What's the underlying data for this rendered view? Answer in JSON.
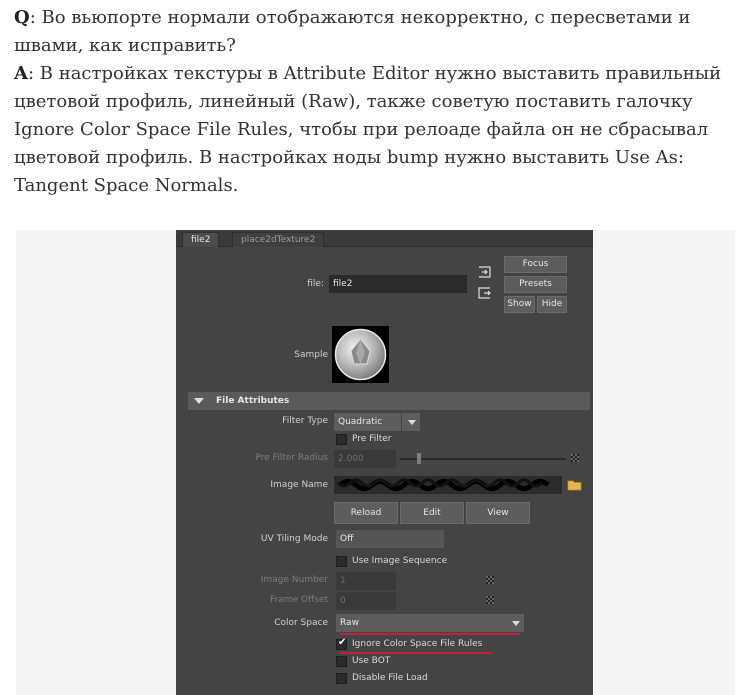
{
  "qa": {
    "q_label": "Q",
    "q_text": ": Во вьюпорте нормали отображаются некорректно, с пересветами и швами, как исправить?",
    "a_label": "A",
    "a_text": ": В настройках текстуры в Attribute Editor нужно выставить правильный цветовой профиль, линейный (Raw), также советую поставить галочку Ignore Color Space File Rules, чтобы при релоаде файла он не сбрасывал цветовой профиль. В настройках ноды bump нужно выставить Use As: Tangent Space Normals."
  },
  "editor": {
    "tabs": [
      {
        "label": "file2",
        "active": true
      },
      {
        "label": "place2dTexture2",
        "active": false
      }
    ],
    "node": {
      "label": "file:",
      "value": "file2"
    },
    "buttons": {
      "focus": "Focus",
      "presets": "Presets",
      "show": "Show",
      "hide": "Hide"
    },
    "sample_label": "Sample",
    "section_title": "File Attributes",
    "filter_type": {
      "label": "Filter Type",
      "value": "Quadratic"
    },
    "pre_filter": {
      "label": "Pre Filter",
      "checked": false
    },
    "pre_filter_radius": {
      "label": "Pre Filter Radius",
      "value": "2.000"
    },
    "image_name": {
      "label": "Image Name"
    },
    "image_buttons": {
      "reload": "Reload",
      "edit": "Edit",
      "view": "View"
    },
    "uv_tiling": {
      "label": "UV Tiling Mode",
      "value": "Off"
    },
    "use_image_sequence": {
      "label": "Use Image Sequence",
      "checked": false
    },
    "image_number": {
      "label": "Image Number",
      "value": "1"
    },
    "frame_offset": {
      "label": "Frame Offset",
      "value": "0"
    },
    "color_space": {
      "label": "Color Space",
      "value": "Raw"
    },
    "ignore_cs_rules": {
      "label": "Ignore Color Space File Rules",
      "checked": true
    },
    "use_bot": {
      "label": "Use BOT",
      "checked": false
    },
    "disable_file_load": {
      "label": "Disable File Load",
      "checked": false
    }
  },
  "colors": {
    "panel": "#444444",
    "field": "#2b2b2b",
    "annotation": "#c0203a"
  }
}
